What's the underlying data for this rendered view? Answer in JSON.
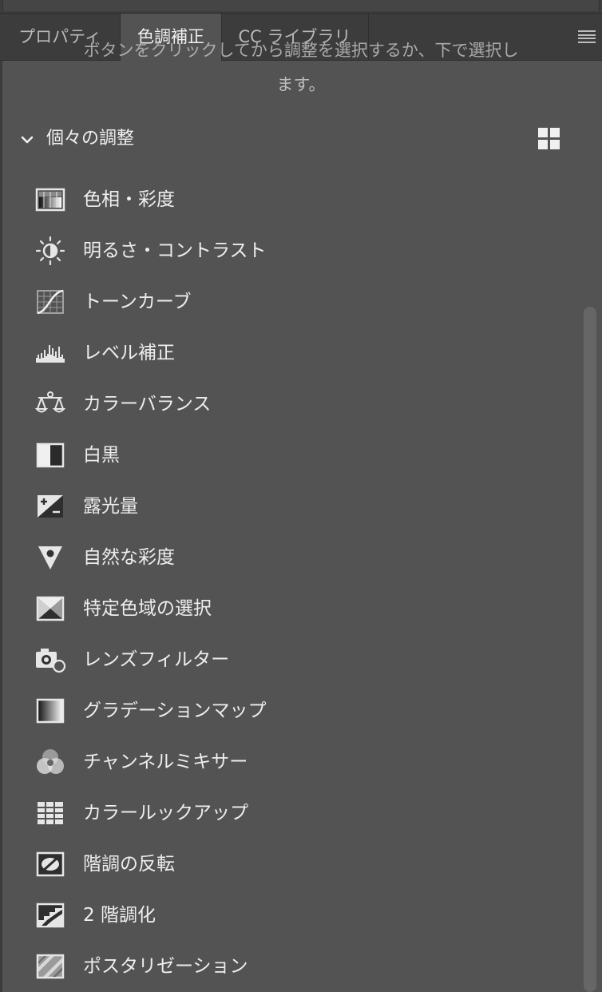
{
  "tabs": [
    {
      "label": "プロパティ",
      "active": false
    },
    {
      "label": "色調補正",
      "active": true
    },
    {
      "label": "CC ライブラリ",
      "active": false
    }
  ],
  "description": {
    "line1_partial": "ボタンをクリックしてから調整を選択するか、下で選択し",
    "line2": "ます。"
  },
  "section": {
    "title": "個々の調整"
  },
  "items": [
    {
      "label": "色相・彩度",
      "icon": "hue-saturation-icon"
    },
    {
      "label": "明るさ・コントラスト",
      "icon": "brightness-contrast-icon"
    },
    {
      "label": "トーンカーブ",
      "icon": "curves-icon"
    },
    {
      "label": "レベル補正",
      "icon": "levels-icon"
    },
    {
      "label": "カラーバランス",
      "icon": "color-balance-icon"
    },
    {
      "label": "白黒",
      "icon": "black-white-icon"
    },
    {
      "label": "露光量",
      "icon": "exposure-icon"
    },
    {
      "label": "自然な彩度",
      "icon": "vibrance-icon"
    },
    {
      "label": "特定色域の選択",
      "icon": "selective-color-icon"
    },
    {
      "label": "レンズフィルター",
      "icon": "photo-filter-icon"
    },
    {
      "label": "グラデーションマップ",
      "icon": "gradient-map-icon"
    },
    {
      "label": "チャンネルミキサー",
      "icon": "channel-mixer-icon"
    },
    {
      "label": "カラールックアップ",
      "icon": "color-lookup-icon"
    },
    {
      "label": "階調の反転",
      "icon": "invert-icon"
    },
    {
      "label": "2 階調化",
      "icon": "threshold-icon"
    },
    {
      "label": "ポスタリゼーション",
      "icon": "posterize-icon"
    }
  ],
  "colors": {
    "panel_bg": "#535353",
    "tabbar_bg": "#3c3c3c",
    "text": "#eeeeee"
  }
}
